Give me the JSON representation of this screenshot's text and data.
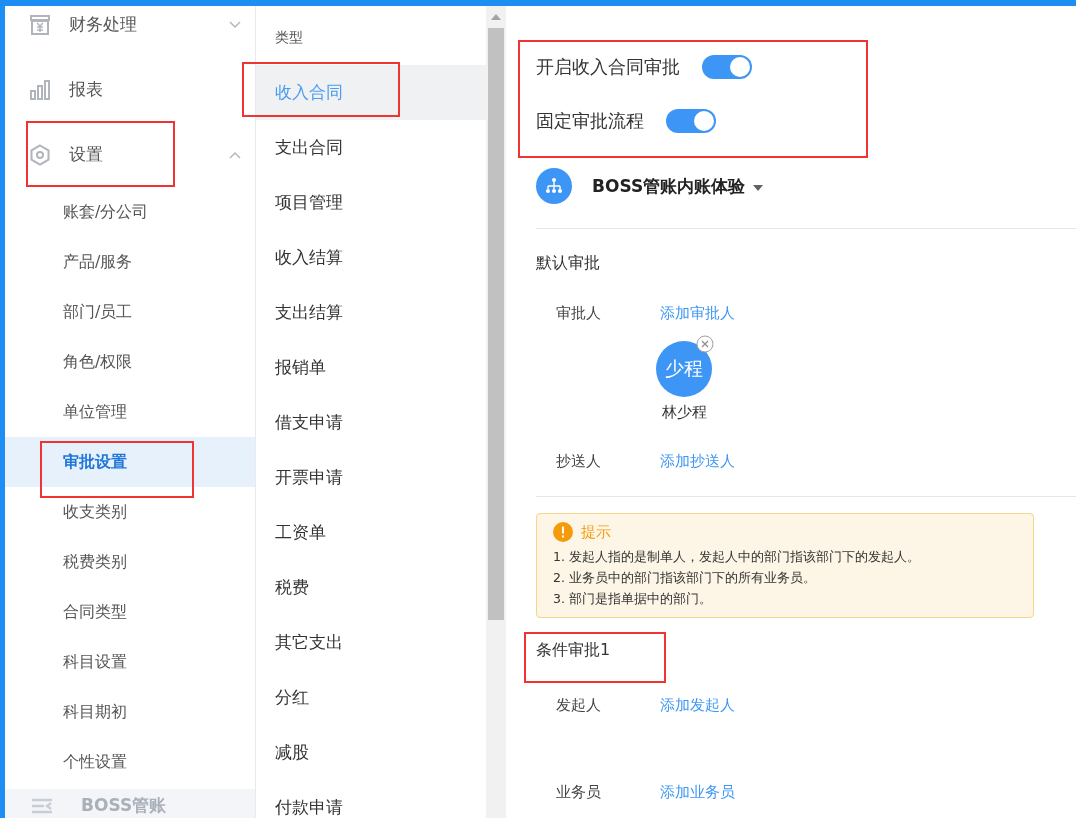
{
  "sidebar": {
    "items": [
      {
        "label": "财务处理",
        "kind": "cash",
        "expanded": false
      },
      {
        "label": "报表",
        "kind": "chart"
      },
      {
        "label": "设置",
        "kind": "settings",
        "expanded": true,
        "children": [
          {
            "label": "账套/分公司",
            "selected": false
          },
          {
            "label": "产品/服务",
            "selected": false
          },
          {
            "label": "部门/员工",
            "selected": false
          },
          {
            "label": "角色/权限",
            "selected": false
          },
          {
            "label": "单位管理",
            "selected": false
          },
          {
            "label": "审批设置",
            "selected": true
          },
          {
            "label": "收支类别",
            "selected": false
          },
          {
            "label": "税费类别",
            "selected": false
          },
          {
            "label": "合同类型",
            "selected": false
          },
          {
            "label": "科目设置",
            "selected": false
          },
          {
            "label": "科目期初",
            "selected": false
          },
          {
            "label": "个性设置",
            "selected": false
          }
        ]
      }
    ],
    "footer": {
      "label": "BOSS管账"
    }
  },
  "types": {
    "heading": "类型",
    "items": [
      {
        "label": "收入合同",
        "selected": true
      },
      {
        "label": "支出合同",
        "selected": false
      },
      {
        "label": "项目管理",
        "selected": false
      },
      {
        "label": "收入结算",
        "selected": false
      },
      {
        "label": "支出结算",
        "selected": false
      },
      {
        "label": "报销单",
        "selected": false
      },
      {
        "label": "借支申请",
        "selected": false
      },
      {
        "label": "开票申请",
        "selected": false
      },
      {
        "label": "工资单",
        "selected": false
      },
      {
        "label": "税费",
        "selected": false
      },
      {
        "label": "其它支出",
        "selected": false
      },
      {
        "label": "分红",
        "selected": false
      },
      {
        "label": "减股",
        "selected": false
      },
      {
        "label": "付款申请",
        "selected": false
      }
    ]
  },
  "switches": [
    {
      "label": "开启收入合同审批",
      "on": true
    },
    {
      "label": "固定审批流程",
      "on": true
    }
  ],
  "organization": {
    "name": "BOSS管账内账体验"
  },
  "default_approval": {
    "title": "默认审批",
    "approver": {
      "label": "审批人",
      "action": "添加审批人",
      "people": [
        {
          "initials": "少程",
          "name": "林少程"
        }
      ]
    },
    "cc": {
      "label": "抄送人",
      "action": "添加抄送人"
    }
  },
  "notice": {
    "title": "提示",
    "lines": [
      "1. 发起人指的是制单人，发起人中的部门指该部门下的发起人。",
      "2. 业务员中的部门指该部门下的所有业务员。",
      "3. 部门是指单据中的部门。"
    ]
  },
  "condition_approval": {
    "title": "条件审批1",
    "rows": [
      {
        "label": "发起人",
        "action": "添加发起人"
      },
      {
        "label": "业务员",
        "action": "添加业务员"
      }
    ]
  }
}
